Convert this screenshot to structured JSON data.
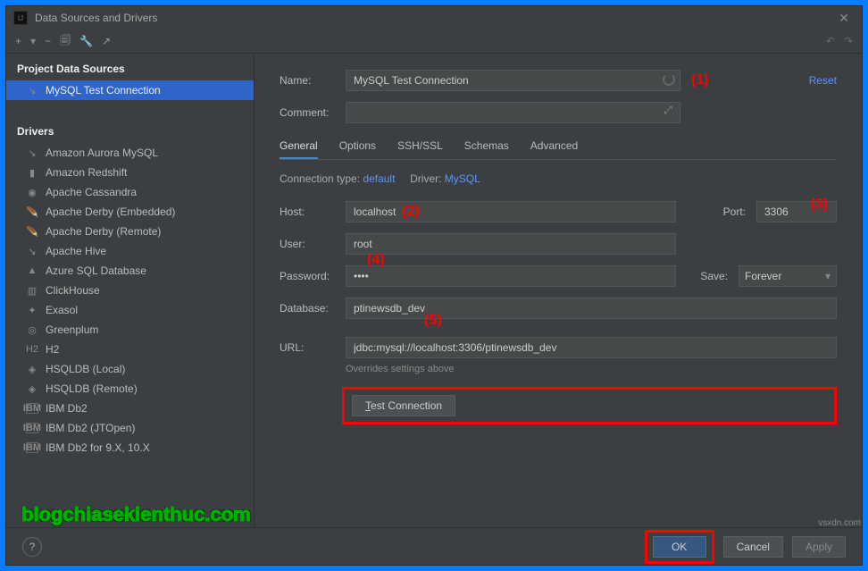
{
  "titlebar": {
    "title": "Data Sources and Drivers"
  },
  "toolbar": {
    "add": "+",
    "sub": "−",
    "copy": "🗐",
    "wrench": "🔧",
    "undo_left": "↶",
    "redo_right": "↷"
  },
  "sidebar": {
    "project_header": "Project Data Sources",
    "selected_source": "MySQL Test Connection",
    "drivers_header": "Drivers",
    "drivers": [
      {
        "icon": "↘",
        "label": "Amazon Aurora MySQL"
      },
      {
        "icon": "▮",
        "label": "Amazon Redshift"
      },
      {
        "icon": "◉",
        "label": "Apache Cassandra"
      },
      {
        "icon": "🪶",
        "label": "Apache Derby (Embedded)"
      },
      {
        "icon": "🪶",
        "label": "Apache Derby (Remote)"
      },
      {
        "icon": "↘",
        "label": "Apache Hive"
      },
      {
        "icon": "▲",
        "label": "Azure SQL Database"
      },
      {
        "icon": "▥",
        "label": "ClickHouse"
      },
      {
        "icon": "✦",
        "label": "Exasol"
      },
      {
        "icon": "◎",
        "label": "Greenplum"
      },
      {
        "icon": "H2",
        "label": "H2"
      },
      {
        "icon": "◈",
        "label": "HSQLDB (Local)"
      },
      {
        "icon": "◈",
        "label": "HSQLDB (Remote)"
      },
      {
        "icon": "IBM",
        "label": "IBM Db2"
      },
      {
        "icon": "IBM",
        "label": "IBM Db2 (JTOpen)"
      },
      {
        "icon": "IBM",
        "label": "IBM Db2 for 9.X, 10.X"
      }
    ]
  },
  "main": {
    "name_label": "Name:",
    "name_value": "MySQL Test Connection",
    "reset": "Reset",
    "comment_label": "Comment:",
    "tabs": [
      "General",
      "Options",
      "SSH/SSL",
      "Schemas",
      "Advanced"
    ],
    "conn_type_label": "Connection type:",
    "conn_type_value": "default",
    "driver_label": "Driver:",
    "driver_value": "MySQL",
    "host_label": "Host:",
    "host_value": "localhost",
    "port_label": "Port:",
    "port_value": "3306",
    "user_label": "User:",
    "user_value": "root",
    "password_label": "Password:",
    "password_value": "••••",
    "save_label": "Save:",
    "save_value": "Forever",
    "database_label": "Database:",
    "database_value": "ptinewsdb_dev",
    "url_label": "URL:",
    "url_value": "jdbc:mysql://localhost:3306/ptinewsdb_dev",
    "url_note": "Overrides settings above",
    "test_connection": "Test Connection"
  },
  "footer": {
    "ok": "OK",
    "cancel": "Cancel",
    "apply": "Apply"
  },
  "annotations": {
    "1": "(1)",
    "2": "(2)",
    "3": "(3)",
    "4": "(4)",
    "5": "(5)"
  },
  "watermark": "blogchiasekienthuc.com",
  "watermark_site": "vsxdn.com"
}
